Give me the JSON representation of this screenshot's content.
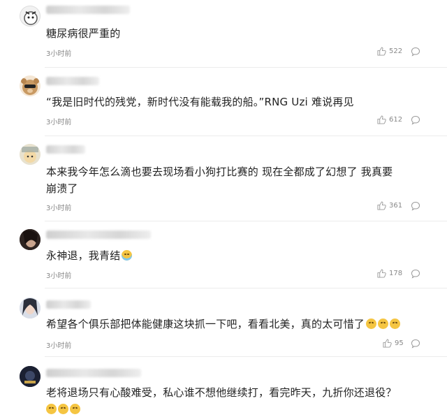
{
  "comments": [
    {
      "text": "糖尿病很严重的",
      "time": "3小时前",
      "likes": "522"
    },
    {
      "text": "“我是旧时代的残党，新时代没有能载我的船。”RNG Uzi 难说再见",
      "time": "3小时前",
      "likes": "612"
    },
    {
      "text_line1": "本来我今年怎么滴也要去现场看小狗打比赛的 现在全都成了幻想了 我真要",
      "text_line2": "崩溃了",
      "time": "3小时前",
      "likes": "361"
    },
    {
      "text": "永神退，我青结",
      "time": "3小时前",
      "likes": "178"
    },
    {
      "text": "希望各个俱乐部把体能健康这块抓一下吧，看看北美，真的太可惜了",
      "time": "3小时前",
      "likes": "95"
    },
    {
      "text": "老将退场只有心酸难受，私心谁不想他继续打，看完昨天，九折你还退役？"
    }
  ],
  "icons": {
    "like": "thumbs-up-icon",
    "reply": "speech-bubble-icon",
    "emoji_cry": "crying-face-emoji",
    "emoji_worry": "worried-face-emoji"
  },
  "colors": {
    "meta": "#888888",
    "text": "#222222",
    "separator": "#ececec"
  }
}
